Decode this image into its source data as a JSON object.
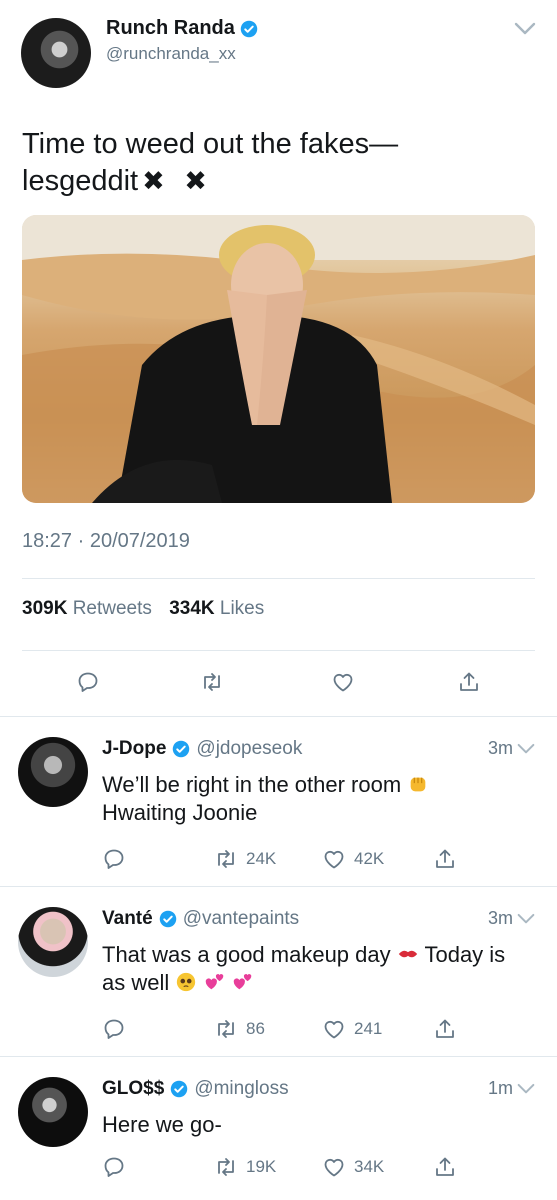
{
  "main_tweet": {
    "author_name": "Runch Randa",
    "author_handle": "@runchranda_xx",
    "text": "Time to weed out the fakes—lesgeddit",
    "text_marks": "✖ ✖",
    "timestamp": "18:27 · 20/07/2019",
    "retweets_count": "309K",
    "retweets_label": "Retweets",
    "likes_count": "334K",
    "likes_label": "Likes"
  },
  "replies": [
    {
      "name": "J-Dope",
      "handle": "@jdopeseok",
      "time": "3m",
      "text": "We’ll be right in the other room",
      "text_end": "Hwaiting Joonie",
      "retweets": "24K",
      "likes": "42K"
    },
    {
      "name": "Vanté",
      "handle": "@vantepaints",
      "time": "3m",
      "text": "That was a good makeup day",
      "text_mid": "Today is as well",
      "retweets": "86",
      "likes": "241"
    },
    {
      "name": "GLO$$",
      "handle": "@mingloss",
      "time": "1m",
      "text": "Here we go-",
      "retweets": "19K",
      "likes": "34K"
    }
  ],
  "colors": {
    "text": "#14171a",
    "muted": "#657786",
    "verified": "#1da1f2",
    "divider": "#e1e8ed"
  },
  "icons": [
    "verified-badge-icon",
    "chevron-down-icon",
    "reply-icon",
    "retweet-icon",
    "like-icon",
    "share-icon"
  ]
}
